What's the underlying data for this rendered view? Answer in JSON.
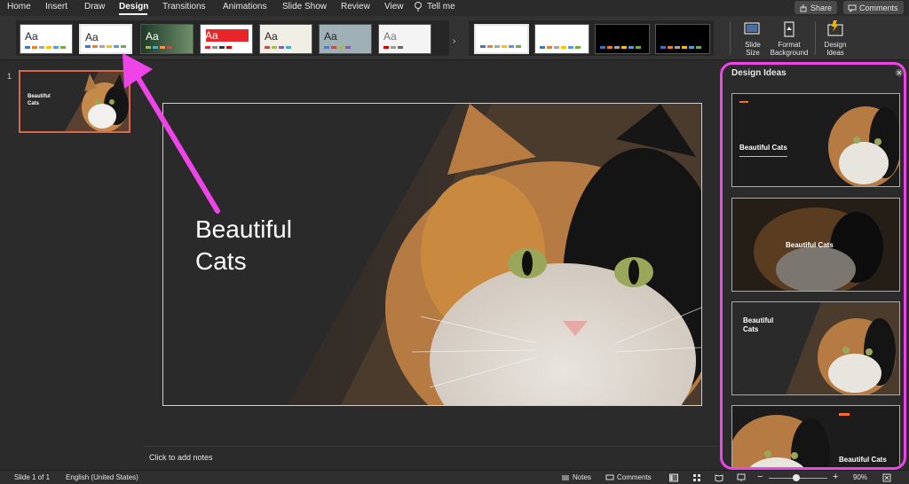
{
  "tabs": [
    {
      "label": "Home",
      "active": false
    },
    {
      "label": "Insert",
      "active": false
    },
    {
      "label": "Draw",
      "active": false
    },
    {
      "label": "Design",
      "active": true
    },
    {
      "label": "Transitions",
      "active": false
    },
    {
      "label": "Animations",
      "active": false
    },
    {
      "label": "Slide Show",
      "active": false
    },
    {
      "label": "Review",
      "active": false
    },
    {
      "label": "View",
      "active": false
    }
  ],
  "tell_me": "Tell me",
  "share_label": "Share",
  "comments_label": "Comments",
  "themes": [
    {
      "label": "Aa",
      "bg": "#ffffff",
      "text": "#222222"
    },
    {
      "label": "Aa",
      "bg": "#ffffff",
      "text": "#222222"
    },
    {
      "label": "Aa",
      "bg": "#2f4f3a",
      "text": "#ffffff"
    },
    {
      "label": "Aa",
      "bg": "#ffffff",
      "text": "#ffffff"
    },
    {
      "label": "Aa",
      "bg": "#f1eee6",
      "text": "#333333"
    },
    {
      "label": "Aa",
      "bg": "#9fb0b6",
      "text": "#222222"
    },
    {
      "label": "Aa",
      "bg": "#f4f4f4",
      "text": "#777777"
    }
  ],
  "variants": [
    {
      "bg": "#ffffff"
    },
    {
      "bg": "#ffffff"
    },
    {
      "bg": "#000000"
    },
    {
      "bg": "#000000"
    }
  ],
  "ribbon_buttons": {
    "slide_size": "Slide\nSize",
    "format_background": "Format\nBackground",
    "design_ideas": "Design\nIdeas"
  },
  "thumbnail": {
    "number": "1",
    "title": "Beautiful\nCats"
  },
  "slide": {
    "title": "Beautiful\nCats"
  },
  "notes_placeholder": "Click to add notes",
  "design_ideas": {
    "title": "Design Ideas",
    "ideas": [
      {
        "label": "Beautiful Cats"
      },
      {
        "label": "Beautiful Cats"
      },
      {
        "label": "Beautiful\nCats"
      },
      {
        "label": "Beautiful Cats"
      }
    ]
  },
  "status": {
    "slide_info": "Slide 1 of 1",
    "language": "English (United States)",
    "notes": "Notes",
    "comments": "Comments",
    "zoom": "90%"
  },
  "colors": {
    "accent_arrow": "#ee44e8",
    "thumb_border": "#d9674b",
    "idea_accent": "#ff6a2b"
  }
}
